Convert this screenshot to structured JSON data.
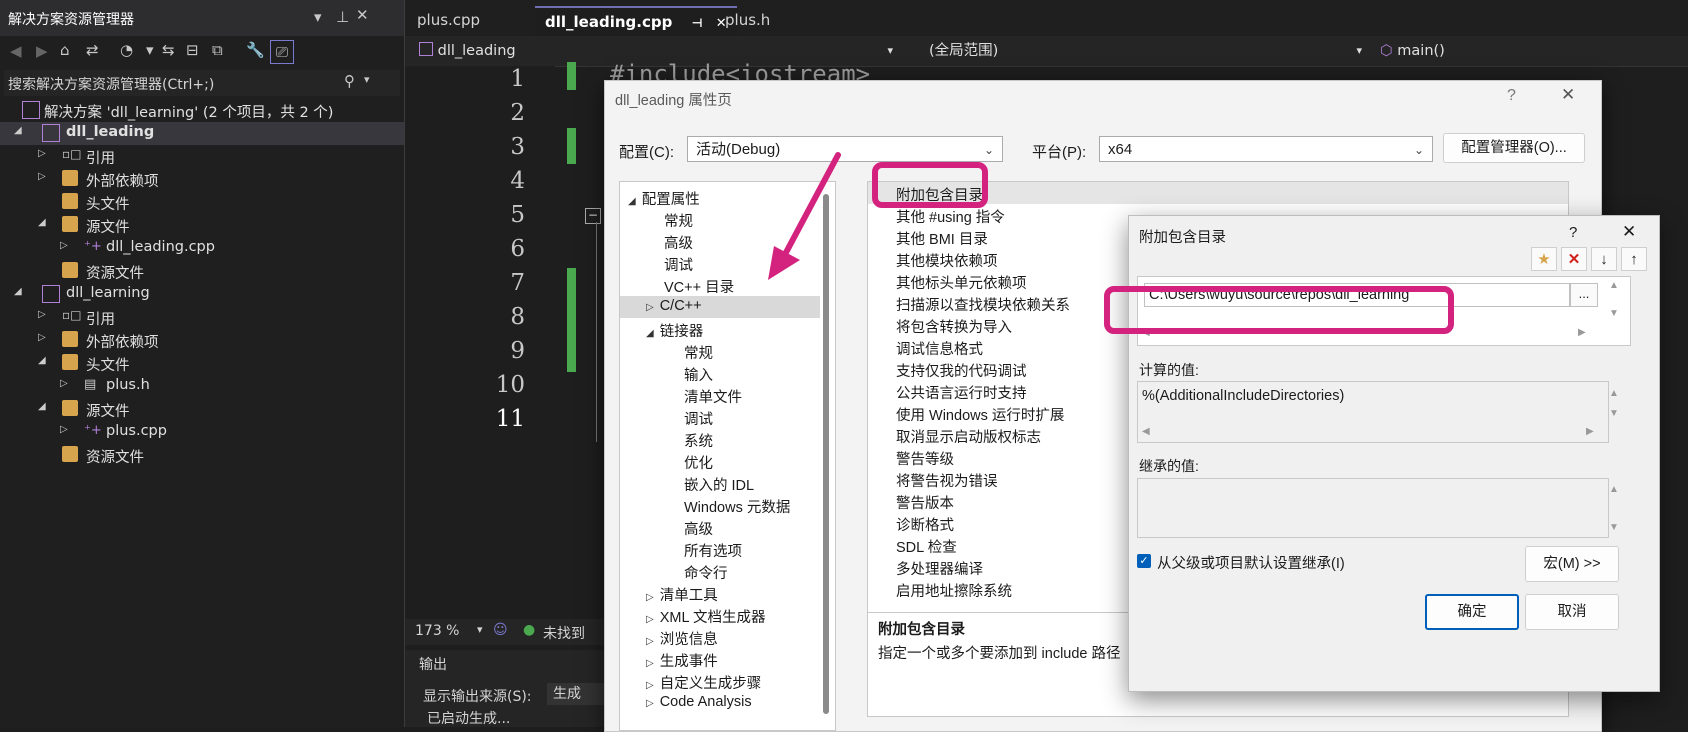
{
  "solution_explorer": {
    "title": "解决方案资源管理器",
    "search_placeholder": "搜索解决方案资源管理器(Ctrl+;)",
    "tree": [
      {
        "label": "解决方案 'dll_learning' (2 个项目，共 2 个)"
      },
      {
        "label": "dll_leading"
      },
      {
        "label": "引用"
      },
      {
        "label": "外部依赖项"
      },
      {
        "label": "头文件"
      },
      {
        "label": "源文件"
      },
      {
        "label": "dll_leading.cpp"
      },
      {
        "label": "资源文件"
      },
      {
        "label": "dll_learning"
      },
      {
        "label": "引用"
      },
      {
        "label": "外部依赖项"
      },
      {
        "label": "头文件"
      },
      {
        "label": "plus.h"
      },
      {
        "label": "源文件"
      },
      {
        "label": "plus.cpp"
      },
      {
        "label": "资源文件"
      }
    ]
  },
  "editor": {
    "tabs": [
      "plus.cpp",
      "dll_leading.cpp",
      "plus.h"
    ],
    "nav_project": "dll_leading",
    "nav_scope": "(全局范围)",
    "nav_member": "main()",
    "line_numbers": [
      "1",
      "2",
      "3",
      "4",
      "5",
      "6",
      "7",
      "8",
      "9",
      "10",
      "11"
    ],
    "code_line1": "#include<iostream>",
    "zoom": "173 %",
    "status_text": "未找到",
    "output_title": "输出",
    "output_source_label": "显示输出来源(S):",
    "output_source_value": "生成",
    "output_line": "已启动生成..."
  },
  "property_page": {
    "title": "dll_leading 属性页",
    "help": "?",
    "config_label": "配置(C):",
    "config_value": "活动(Debug)",
    "platform_label": "平台(P):",
    "platform_value": "x64",
    "config_manager": "配置管理器(O)...",
    "tree": [
      {
        "label": "配置属性"
      },
      {
        "label": "常规"
      },
      {
        "label": "高级"
      },
      {
        "label": "调试"
      },
      {
        "label": "VC++ 目录"
      },
      {
        "label": "C/C++"
      },
      {
        "label": "链接器"
      },
      {
        "label": "常规"
      },
      {
        "label": "输入"
      },
      {
        "label": "清单文件"
      },
      {
        "label": "调试"
      },
      {
        "label": "系统"
      },
      {
        "label": "优化"
      },
      {
        "label": "嵌入的 IDL"
      },
      {
        "label": "Windows 元数据"
      },
      {
        "label": "高级"
      },
      {
        "label": "所有选项"
      },
      {
        "label": "命令行"
      },
      {
        "label": "清单工具"
      },
      {
        "label": "XML 文档生成器"
      },
      {
        "label": "浏览信息"
      },
      {
        "label": "生成事件"
      },
      {
        "label": "自定义生成步骤"
      },
      {
        "label": "Code Analysis"
      }
    ],
    "properties": [
      "附加包含目录",
      "其他 #using 指令",
      "其他 BMI 目录",
      "其他模块依赖项",
      "其他标头单元依赖项",
      "扫描源以查找模块依赖关系",
      "将包含转换为导入",
      "调试信息格式",
      "支持仅我的代码调试",
      "公共语言运行时支持",
      "使用 Windows 运行时扩展",
      "取消显示启动版权标志",
      "警告等级",
      "将警告视为错误",
      "警告版本",
      "诊断格式",
      "SDL 检查",
      "多处理器编译",
      "启用地址擦除系统"
    ],
    "desc_title": "附加包含目录",
    "desc_text": "指定一个或多个要添加到 include 路径"
  },
  "include_dialog": {
    "title": "附加包含目录",
    "help": "?",
    "path_value": "C:\\Users\\wuyu\\source\\repos\\dll_learning",
    "browse": "...",
    "computed_label": "计算的值:",
    "computed_value": "%(AdditionalIncludeDirectories)",
    "inherited_label": "继承的值:",
    "inherit_checkbox": "从父级或项目默认设置继承(I)",
    "macro_button": "宏(M) >>",
    "ok": "确定",
    "cancel": "取消"
  },
  "colors": {
    "callout": "#d4237f",
    "green_change_bar": "#4aa84f",
    "selection": "#37373d"
  }
}
